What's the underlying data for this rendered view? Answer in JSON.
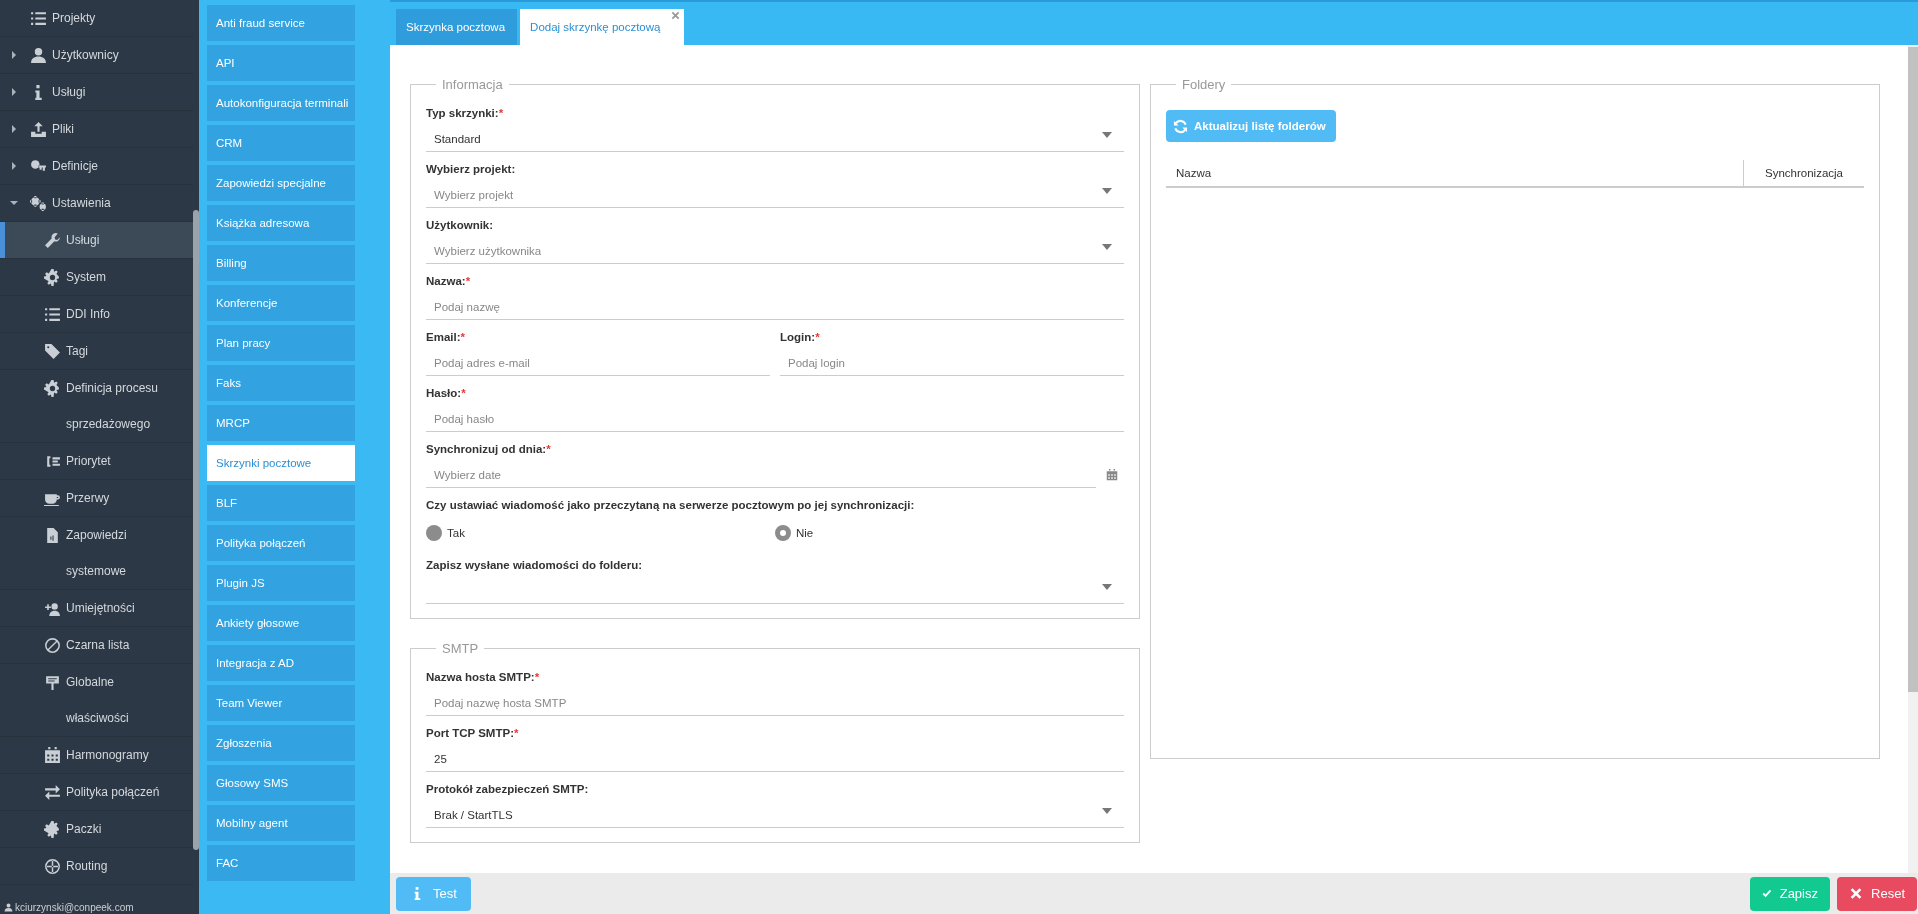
{
  "sidebar": {
    "items": [
      {
        "label": "Projekty",
        "selected": false
      },
      {
        "label": "Użytkownicy",
        "selected": false,
        "expanded": false
      },
      {
        "label": "Usługi",
        "selected": false,
        "expanded": false
      },
      {
        "label": "Pliki",
        "selected": false,
        "expanded": false
      },
      {
        "label": "Definicje",
        "selected": false,
        "expanded": false
      },
      {
        "label": "Ustawienia",
        "selected": false,
        "expanded": true,
        "children": [
          {
            "label": "Usługi",
            "selected": true
          },
          {
            "label": "System",
            "selected": false
          },
          {
            "label": "DDI Info",
            "selected": false
          },
          {
            "label": "Tagi",
            "selected": false
          },
          {
            "label": "Definicja procesu sprzedażowego",
            "selected": false
          },
          {
            "label": "Priorytet",
            "selected": false
          },
          {
            "label": "Przerwy",
            "selected": false
          },
          {
            "label": "Zapowiedzi systemowe",
            "selected": false
          },
          {
            "label": "Umiejętności",
            "selected": false
          },
          {
            "label": "Czarna lista",
            "selected": false
          },
          {
            "label": "Globalne właściwości",
            "selected": false
          },
          {
            "label": "Harmonogramy",
            "selected": false
          },
          {
            "label": "Polityka połączeń",
            "selected": false
          },
          {
            "label": "Paczki",
            "selected": false
          },
          {
            "label": "Routing",
            "selected": false
          }
        ]
      }
    ],
    "user": "kciurzynski@conpeek.com"
  },
  "modules": {
    "items": [
      {
        "label": "Anti fraud service",
        "selected": false
      },
      {
        "label": "API",
        "selected": false
      },
      {
        "label": "Autokonfiguracja terminali",
        "selected": false
      },
      {
        "label": "CRM",
        "selected": false
      },
      {
        "label": "Zapowiedzi specjalne",
        "selected": false
      },
      {
        "label": "Książka adresowa",
        "selected": false
      },
      {
        "label": "Billing",
        "selected": false
      },
      {
        "label": "Konferencje",
        "selected": false
      },
      {
        "label": "Plan pracy",
        "selected": false
      },
      {
        "label": "Faks",
        "selected": false
      },
      {
        "label": "MRCP",
        "selected": false
      },
      {
        "label": "Skrzynki pocztowe",
        "selected": true
      },
      {
        "label": "BLF",
        "selected": false
      },
      {
        "label": "Polityka połączeń",
        "selected": false
      },
      {
        "label": "Plugin JS",
        "selected": false
      },
      {
        "label": "Ankiety głosowe",
        "selected": false
      },
      {
        "label": "Integracja z AD",
        "selected": false
      },
      {
        "label": "Team Viewer",
        "selected": false
      },
      {
        "label": "Zgłoszenia",
        "selected": false
      },
      {
        "label": "Głosowy SMS",
        "selected": false
      },
      {
        "label": "Mobilny agent",
        "selected": false
      },
      {
        "label": "FAC",
        "selected": false
      }
    ]
  },
  "tabs": [
    {
      "label": "Skrzynka pocztowa",
      "selected": false,
      "closable": false
    },
    {
      "label": "Dodaj skrzynkę pocztową",
      "selected": true,
      "closable": true
    }
  ],
  "sections": [
    {
      "legend": "Informacja",
      "fields": [
        {
          "kind": "select",
          "label": "Typ skrzynki:",
          "required_mark": "*",
          "value": "Standard"
        },
        {
          "kind": "select",
          "label": "Wybierz projekt:",
          "placeholder": "Wybierz projekt"
        },
        {
          "kind": "select",
          "label": "Użytkownik:",
          "placeholder": "Wybierz użytkownika"
        },
        {
          "kind": "text",
          "label": "Nazwa:",
          "required_mark": "*",
          "placeholder": "Podaj nazwę"
        },
        {
          "kind": "pair",
          "fields": [
            {
              "label": "Email:",
              "required_mark": "*",
              "placeholder": "Podaj adres e-mail"
            },
            {
              "label": "Login:",
              "required_mark": "*",
              "placeholder": "Podaj login"
            }
          ]
        },
        {
          "kind": "text",
          "label": "Hasło:",
          "required_mark": "*",
          "placeholder": "Podaj hasło"
        },
        {
          "kind": "date",
          "label": "Synchronizuj od dnia:",
          "required_mark": "*",
          "placeholder": "Wybierz date"
        },
        {
          "kind": "radio",
          "label": "Czy ustawiać wiadomość jako przeczytaną na serwerze pocztowym po jej synchronizacji:",
          "options": [
            {
              "label": "Tak",
              "selected": false
            },
            {
              "label": "Nie",
              "selected": true
            }
          ]
        },
        {
          "kind": "select",
          "label": "Zapisz wysłane wiadomości do folderu:"
        }
      ]
    },
    {
      "legend": "SMTP",
      "fields": [
        {
          "kind": "text",
          "label": "Nazwa hosta SMTP:",
          "required_mark": "*",
          "placeholder": "Podaj nazwę hosta SMTP"
        },
        {
          "kind": "text",
          "label": "Port TCP SMTP:",
          "required_mark": "*",
          "value": "25"
        },
        {
          "kind": "select",
          "label": "Protokół zabezpieczeń SMTP:",
          "value": "Brak / StartTLS"
        }
      ]
    }
  ],
  "folders": {
    "legend": "Foldery",
    "button": "Aktualizuj listę folderów",
    "columns": [
      "Nazwa",
      "Synchronizacja"
    ]
  },
  "actions": [
    {
      "kind": "test",
      "label": "Test"
    },
    {
      "kind": "save",
      "label": "Zapisz"
    },
    {
      "kind": "reset",
      "label": "Reset"
    }
  ]
}
